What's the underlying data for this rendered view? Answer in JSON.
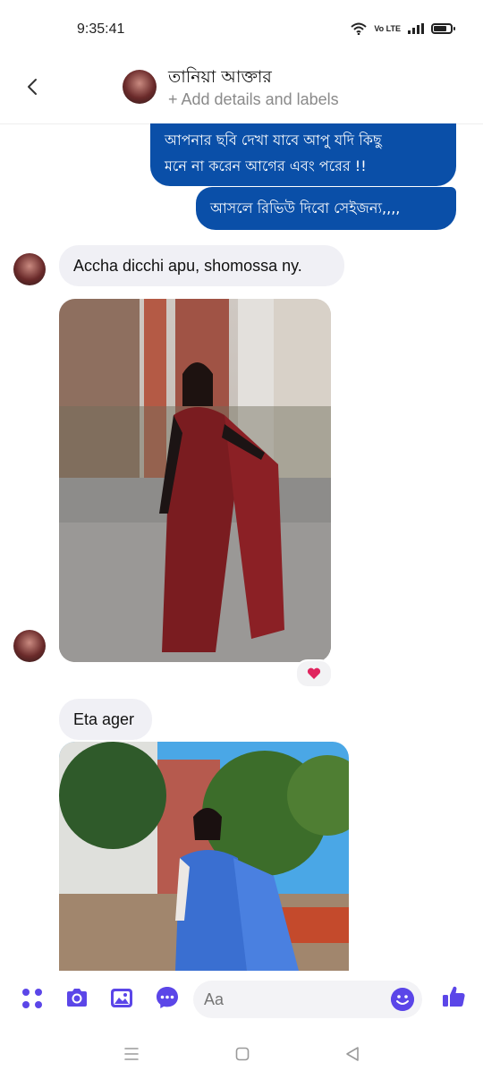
{
  "status": {
    "time": "9:35:41",
    "volte": "Vo LTE",
    "battery_level": 0.75
  },
  "header": {
    "contact_name": "তানিয়া আক্তার",
    "subtitle": "+ Add details and labels"
  },
  "messages": {
    "out1": "আপনার ছবি দেখা যাবে আপু যদি কিছু মনে না করেন আগের এবং পরের !!",
    "out1_line1": "আপনার ছবি দেখা যাবে আপু যদি কিছু",
    "out1_line2": "মনে না করেন আগের এবং পরের !!",
    "out2": "আসলে রিভিউ দিবো সেইজন্য,,,,",
    "in1": "Accha dicchi apu, shomossa ny.",
    "in2": "Eta ager"
  },
  "reaction": {
    "icon": "heart-icon",
    "color": "#e0245e"
  },
  "composer": {
    "placeholder": "Aa"
  },
  "colors": {
    "accent": "#5b46e8",
    "outgoing_bubble": "#0a4fa8",
    "incoming_bubble": "#f0f0f5"
  },
  "icons": [
    "menu-dots-icon",
    "camera-icon",
    "gallery-icon",
    "messenger-icon",
    "emoji-icon",
    "thumbs-up-icon"
  ]
}
